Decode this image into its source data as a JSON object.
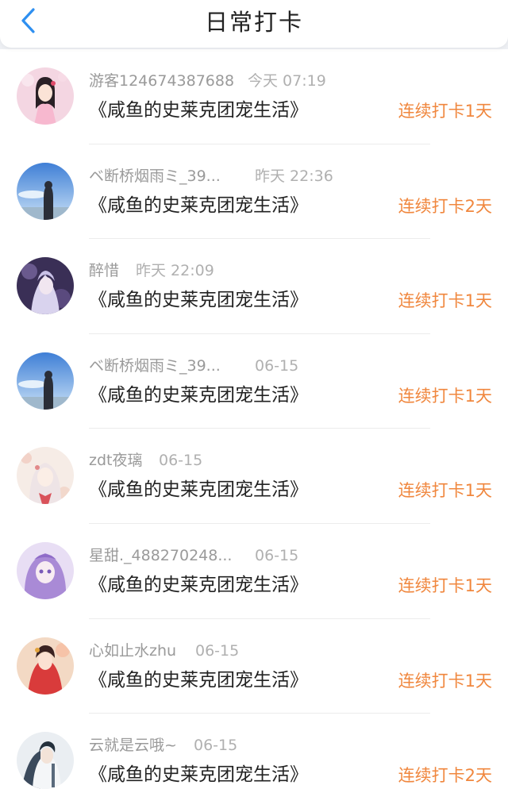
{
  "header": {
    "title": "日常打卡",
    "back_icon": "chevron-left-icon",
    "accent_color": "#2e8ff0"
  },
  "colors": {
    "streak": "#f0873e",
    "name": "#9a9a9a",
    "book": "#222222"
  },
  "entries": [
    {
      "name": "游客124674387688",
      "time": "今天 07:19",
      "book": "《咸鱼的史莱克团宠生活》",
      "streak": "连续打卡1天"
    },
    {
      "name": "ベ断桥烟雨ミ_39...",
      "time": "昨天 22:36",
      "book": "《咸鱼的史莱克团宠生活》",
      "streak": "连续打卡2天"
    },
    {
      "name": "醉惜",
      "time": "昨天 22:09",
      "book": "《咸鱼的史莱克团宠生活》",
      "streak": "连续打卡1天"
    },
    {
      "name": "ベ断桥烟雨ミ_39...",
      "time": "06-15",
      "book": "《咸鱼的史莱克团宠生活》",
      "streak": "连续打卡1天"
    },
    {
      "name": "zdt夜璃",
      "time": "06-15",
      "book": "《咸鱼的史莱克团宠生活》",
      "streak": "连续打卡1天"
    },
    {
      "name": "星甜._488270248...",
      "time": "06-15",
      "book": "《咸鱼的史莱克团宠生活》",
      "streak": "连续打卡1天"
    },
    {
      "name": "心如止水zhu",
      "time": "06-15",
      "book": "《咸鱼的史莱克团宠生活》",
      "streak": "连续打卡1天"
    },
    {
      "name": "云就是云哦~",
      "time": "06-15",
      "book": "《咸鱼的史莱克团宠生活》",
      "streak": "连续打卡2天"
    }
  ]
}
